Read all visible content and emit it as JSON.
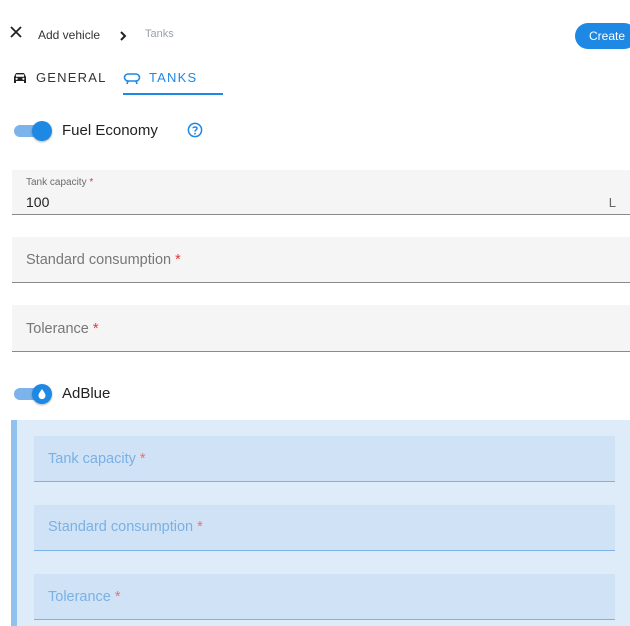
{
  "header": {
    "breadcrumb_add": "Add vehicle",
    "breadcrumb_current": "Tanks",
    "create_label": "Create"
  },
  "tabs": [
    {
      "label": "GENERAL",
      "icon": "car-icon",
      "active": false
    },
    {
      "label": "TANKS",
      "icon": "tank-icon",
      "active": true
    }
  ],
  "fuel_economy": {
    "toggle_label": "Fuel Economy",
    "enabled": true,
    "fields": {
      "tank_capacity": {
        "label": "Tank capacity",
        "required_mark": "*",
        "value": "100",
        "unit": "L"
      },
      "standard_consumption": {
        "placeholder": "Standard consumption",
        "required_mark": "*"
      },
      "tolerance": {
        "placeholder": "Tolerance",
        "required_mark": "*"
      }
    }
  },
  "adblue": {
    "toggle_label": "AdBlue",
    "enabled": true,
    "fields": {
      "tank_capacity": {
        "placeholder": "Tank capacity",
        "required_mark": "*"
      },
      "standard_consumption": {
        "placeholder": "Standard consumption",
        "required_mark": "*"
      },
      "tolerance": {
        "placeholder": "Tolerance",
        "required_mark": "*"
      }
    }
  },
  "colors": {
    "accent": "#1e88e5",
    "required": "#e53935",
    "adblue_panel": "#deebf8"
  }
}
